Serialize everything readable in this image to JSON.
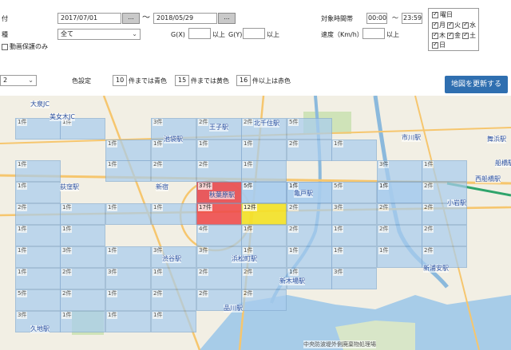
{
  "filters": {
    "date_label": "付",
    "date_from": "2017/07/01",
    "date_btn": "...",
    "tilde": "〜",
    "date_to": "2018/05/29",
    "type_label": "種",
    "type_value": "全て",
    "gx_label": "G(X)",
    "gx_value": "",
    "gx_suffix": "以上",
    "gy_label": "G(Y)",
    "gy_value": "",
    "gy_suffix": "以上",
    "video_only": "動画保護のみ",
    "time_label": "対象時間帯",
    "time_from": "00:00",
    "time_tilde": "〜",
    "time_to": "23:59",
    "speed_label": "速度（Km/h）",
    "speed_value": "",
    "speed_suffix": "以上"
  },
  "weekdays": {
    "header": "曜日",
    "mon": "月",
    "tue": "火",
    "wed": "水",
    "thu": "木",
    "fri": "金",
    "sat": "土",
    "sun": "日"
  },
  "color_settings": {
    "zoom_value": "2",
    "label": "色設定",
    "blue_value": "10",
    "blue_text": "件までは青色",
    "yellow_value": "15",
    "yellow_text": "件までは黄色",
    "red_value": "16",
    "red_text": "件以上は赤色",
    "update_button": "地図を更新する"
  },
  "colors": {
    "accent": "#2f6fb0",
    "blue_cell": "#a9cdee",
    "yellow_cell": "#f4e22a",
    "red_cell": "#ef4a4a"
  },
  "map": {
    "places": [
      "大泉JC",
      "美女木JC",
      "北千住駅",
      "王子駅",
      "池袋駅",
      "秋葉原駅",
      "新宿",
      "亀戸駅",
      "市川駅",
      "荻窪駅",
      "渋谷駅",
      "浜松町駅",
      "新木場駅",
      "新浦安駅",
      "品川駅",
      "久地駅",
      "舞浜駅",
      "船橋駅",
      "西船橋駅",
      "小岩駅"
    ],
    "rails": [
      "JCT",
      "JCT"
    ],
    "attribution": "中央防波堤外側廃棄物処理場",
    "cells": [
      {
        "c": "1件",
        "k": "b"
      },
      {
        "c": "1件",
        "k": "b"
      },
      {
        "c": "3件",
        "k": "b"
      },
      {
        "c": "2件",
        "k": "b"
      },
      {
        "c": "2件",
        "k": "b"
      },
      {
        "c": "5件",
        "k": "b"
      },
      {
        "c": "1件",
        "k": "b"
      },
      {
        "c": "1件",
        "k": "b"
      },
      {
        "c": "1件",
        "k": "b"
      },
      {
        "c": "1件",
        "k": "b"
      },
      {
        "c": "2件",
        "k": "b"
      },
      {
        "c": "1件",
        "k": "b"
      },
      {
        "c": "1件",
        "k": "b"
      },
      {
        "c": "3件",
        "k": "b"
      },
      {
        "c": "1件",
        "k": "b"
      },
      {
        "c": "2件",
        "k": "b"
      },
      {
        "c": "2件",
        "k": "b"
      },
      {
        "c": "1件",
        "k": "b"
      },
      {
        "c": "8件",
        "k": "b"
      },
      {
        "c": "6件",
        "k": "b"
      },
      {
        "c": "1件",
        "k": "b"
      },
      {
        "c": "1件",
        "k": "b"
      },
      {
        "c": "1件",
        "k": "b"
      },
      {
        "c": "1件",
        "k": "b"
      },
      {
        "c": "37件",
        "k": "r"
      },
      {
        "c": "5件",
        "k": "b"
      },
      {
        "c": "1件",
        "k": "b"
      },
      {
        "c": "5件",
        "k": "b"
      },
      {
        "c": "1件",
        "k": "b"
      },
      {
        "c": "2件",
        "k": "b"
      },
      {
        "c": "2件",
        "k": "b"
      },
      {
        "c": "1件",
        "k": "b"
      },
      {
        "c": "1件",
        "k": "b"
      },
      {
        "c": "1件",
        "k": "b"
      },
      {
        "c": "17件",
        "k": "r"
      },
      {
        "c": "12件",
        "k": "y"
      },
      {
        "c": "2件",
        "k": "b"
      },
      {
        "c": "3件",
        "k": "b"
      },
      {
        "c": "2件",
        "k": "b"
      },
      {
        "c": "2件",
        "k": "b"
      },
      {
        "c": "1件",
        "k": "b"
      },
      {
        "c": "1件",
        "k": "b"
      },
      {
        "c": "4件",
        "k": "b"
      },
      {
        "c": "1件",
        "k": "b"
      },
      {
        "c": "2件",
        "k": "b"
      },
      {
        "c": "1件",
        "k": "b"
      },
      {
        "c": "2件",
        "k": "b"
      },
      {
        "c": "2件",
        "k": "b"
      },
      {
        "c": "1件",
        "k": "b"
      },
      {
        "c": "3件",
        "k": "b"
      },
      {
        "c": "1件",
        "k": "b"
      },
      {
        "c": "3件",
        "k": "b"
      },
      {
        "c": "3件",
        "k": "b"
      },
      {
        "c": "1件",
        "k": "b"
      },
      {
        "c": "1件",
        "k": "b"
      },
      {
        "c": "1件",
        "k": "b"
      },
      {
        "c": "1件",
        "k": "b"
      },
      {
        "c": "2件",
        "k": "b"
      },
      {
        "c": "1件",
        "k": "b"
      },
      {
        "c": "2件",
        "k": "b"
      },
      {
        "c": "3件",
        "k": "b"
      },
      {
        "c": "1件",
        "k": "b"
      },
      {
        "c": "2件",
        "k": "b"
      },
      {
        "c": "2件",
        "k": "b"
      },
      {
        "c": "1件",
        "k": "b"
      },
      {
        "c": "3件",
        "k": "b"
      },
      {
        "c": "5件",
        "k": "b"
      },
      {
        "c": "2件",
        "k": "b"
      },
      {
        "c": "1件",
        "k": "b"
      },
      {
        "c": "2件",
        "k": "b"
      },
      {
        "c": "2件",
        "k": "b"
      },
      {
        "c": "2件",
        "k": "b"
      },
      {
        "c": "3件",
        "k": "b"
      },
      {
        "c": "1件",
        "k": "b"
      },
      {
        "c": "1件",
        "k": "b"
      },
      {
        "c": "1件",
        "k": "b"
      }
    ]
  }
}
